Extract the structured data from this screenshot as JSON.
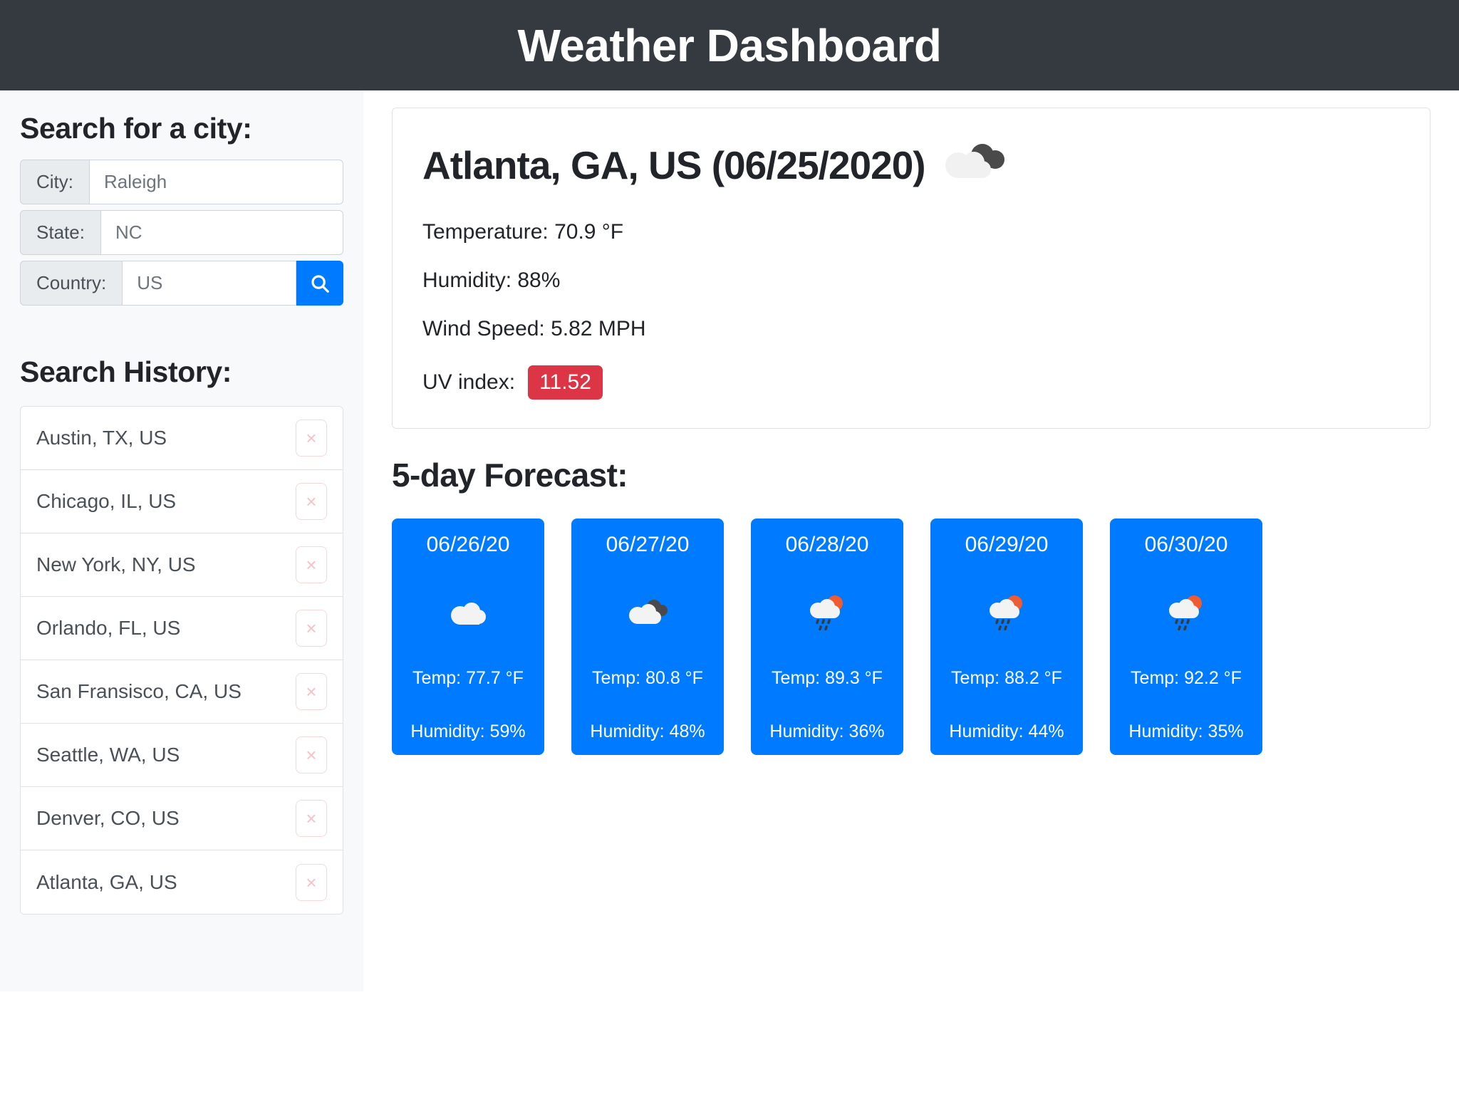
{
  "header": {
    "title": "Weather Dashboard"
  },
  "sidebar": {
    "search_heading": "Search for a city:",
    "fields": [
      {
        "label": "City:",
        "placeholder": "Raleigh",
        "value": ""
      },
      {
        "label": "State:",
        "placeholder": "NC",
        "value": ""
      },
      {
        "label": "Country:",
        "placeholder": "US",
        "value": ""
      }
    ],
    "search_button_icon": "search-icon",
    "history_heading": "Search History:",
    "history": [
      {
        "label": "Austin, TX, US",
        "delete": "×"
      },
      {
        "label": "Chicago, IL, US",
        "delete": "×"
      },
      {
        "label": "New York, NY, US",
        "delete": "×"
      },
      {
        "label": "Orlando, FL, US",
        "delete": "×"
      },
      {
        "label": "San Fransisco, CA, US",
        "delete": "×"
      },
      {
        "label": "Seattle, WA, US",
        "delete": "×"
      },
      {
        "label": "Denver, CO, US",
        "delete": "×"
      },
      {
        "label": "Atlanta, GA, US",
        "delete": "×"
      }
    ]
  },
  "current": {
    "title": "Atlanta, GA, US (06/25/2020)",
    "icon": "broken-clouds-icon",
    "temperature": "Temperature: 70.9 °F",
    "humidity": "Humidity: 88%",
    "wind": "Wind Speed: 5.82 MPH",
    "uv_label": "UV index:",
    "uv_value": "11.52",
    "uv_badge_color": "#dc3545"
  },
  "forecast": {
    "heading": "5-day Forecast:",
    "card_color": "#007bff",
    "days": [
      {
        "date": "06/26/20",
        "icon": "cloud-icon",
        "temp": "Temp: 77.7 °F",
        "humidity": "Humidity: 59%"
      },
      {
        "date": "06/27/20",
        "icon": "broken-clouds-icon",
        "temp": "Temp: 80.8 °F",
        "humidity": "Humidity: 48%"
      },
      {
        "date": "06/28/20",
        "icon": "shower-rain-sun-icon",
        "temp": "Temp: 89.3 °F",
        "humidity": "Humidity: 36%"
      },
      {
        "date": "06/29/20",
        "icon": "shower-rain-sun-icon",
        "temp": "Temp: 88.2 °F",
        "humidity": "Humidity: 44%"
      },
      {
        "date": "06/30/20",
        "icon": "shower-rain-sun-icon",
        "temp": "Temp: 92.2 °F",
        "humidity": "Humidity: 35%"
      }
    ]
  }
}
